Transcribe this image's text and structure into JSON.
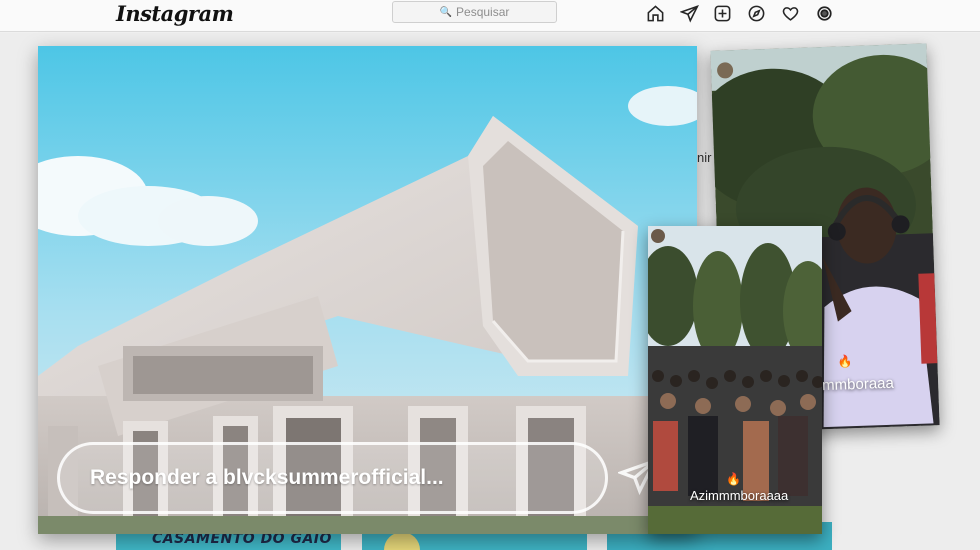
{
  "topnav": {
    "logo": "Instagram",
    "search_placeholder": "Pesquisar",
    "icons": [
      "home-icon",
      "direct-send-icon",
      "new-post-icon",
      "explore-icon",
      "activity-heart-icon",
      "profile-avatar-icon"
    ]
  },
  "feed": {
    "partial_text": "nir e u",
    "thumbnails": [
      {
        "caption": "CASAMENTO DO GAIO"
      },
      {
        "caption": ""
      },
      {
        "caption": ""
      }
    ]
  },
  "story_main": {
    "reply_placeholder": "Responder a blvcksummerofficial..."
  },
  "story_right": {
    "caption": "mmboraaa"
  },
  "story_mid": {
    "caption": "Azimmmboraaaa"
  },
  "colors": {
    "sky_top": "#4dc6e6",
    "building": "#d9d3d0",
    "feed_thumb": "#40b8c8"
  }
}
